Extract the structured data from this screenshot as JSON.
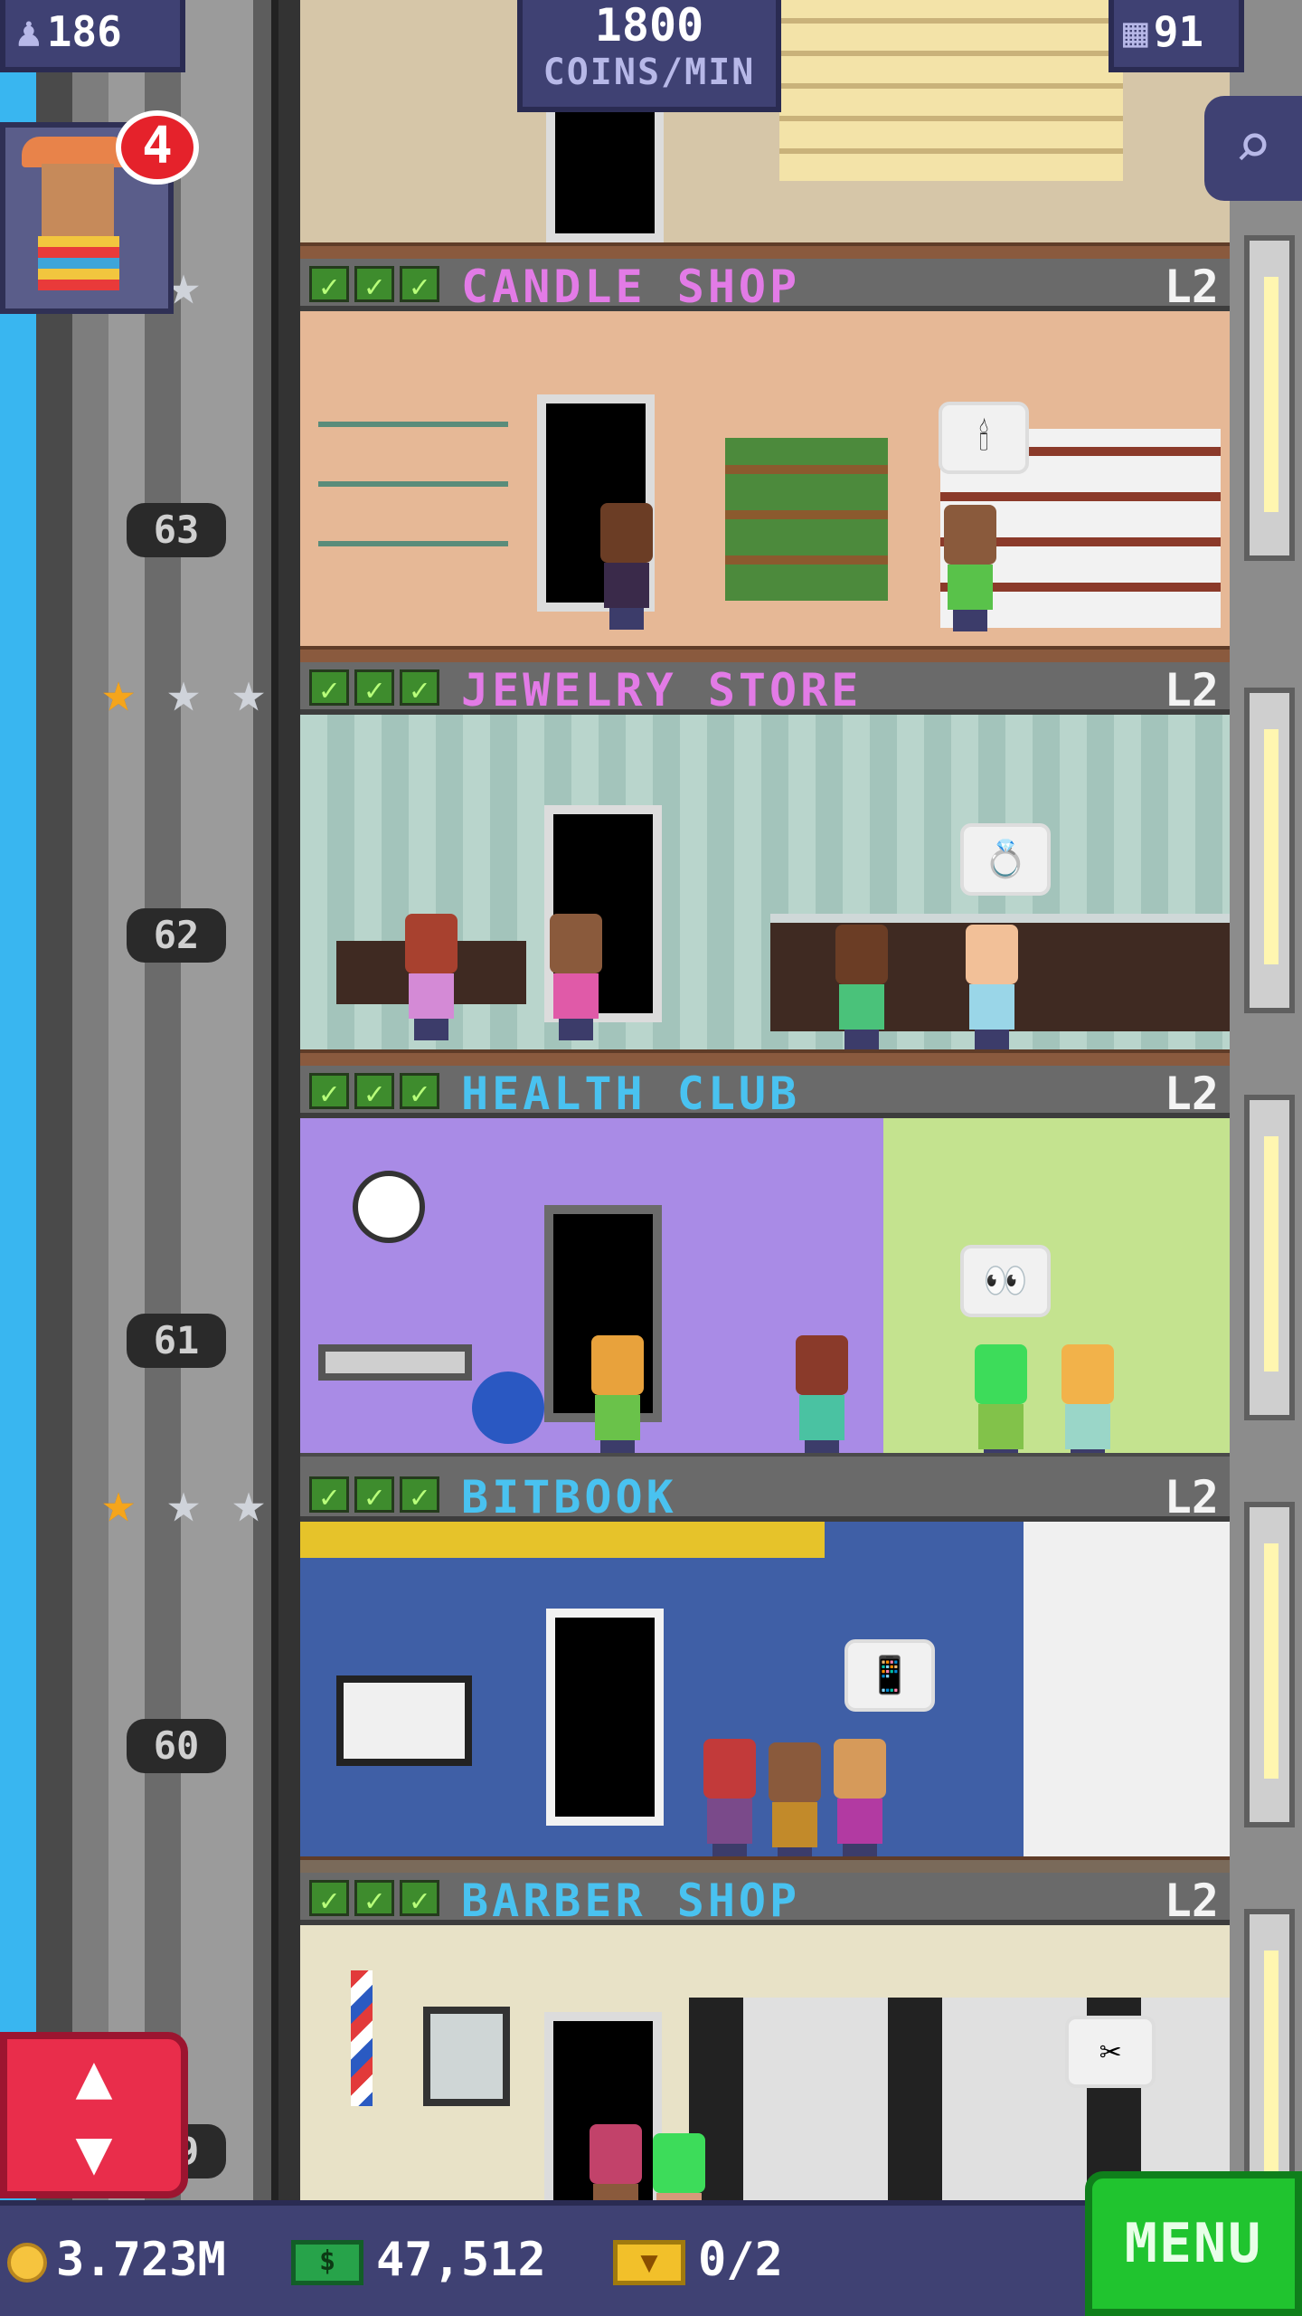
{
  "top_bar": {
    "population": "186",
    "coins_rate": "1800",
    "coins_rate_unit": "COINS/MIN",
    "floor_count": "91"
  },
  "vip": {
    "badge_count": "4"
  },
  "floors": [
    {
      "name": "CANDLE SHOP",
      "level": "L2",
      "name_color": "#e27be6",
      "elevator_number": "63",
      "room_color": "#e6b896"
    },
    {
      "name": "JEWELRY STORE",
      "level": "L2",
      "name_color": "#e27be6",
      "elevator_number": "62",
      "room_color": "#bdd6cf"
    },
    {
      "name": "HEALTH CLUB",
      "level": "L2",
      "name_color": "#49c2f0",
      "elevator_number": "61",
      "room_color": "#a98be6"
    },
    {
      "name": "BITBOOK",
      "level": "L2",
      "name_color": "#49c2f0",
      "elevator_number": "60",
      "room_color": "#3f5fa6"
    },
    {
      "name": "BARBER SHOP",
      "level": "L2",
      "name_color": "#49c2f0",
      "elevator_number": "59",
      "room_color": "#e8e2c7"
    }
  ],
  "star_ratings": [
    {
      "filled": 0,
      "total": 3
    },
    {
      "filled": 1,
      "total": 3
    },
    {
      "filled": 1,
      "total": 3
    }
  ],
  "bottom_bar": {
    "coins": "3.723M",
    "bux": "47,512",
    "tickets": "0/2",
    "menu_label": "MENU"
  },
  "icons": {
    "population": "person-icon",
    "floors": "building-icon",
    "search": "magnifier-icon",
    "elevator": "up-down-arrows-icon",
    "coin": "coin-icon",
    "bux": "bux-icon",
    "ticket": "golden-ticket-icon"
  }
}
